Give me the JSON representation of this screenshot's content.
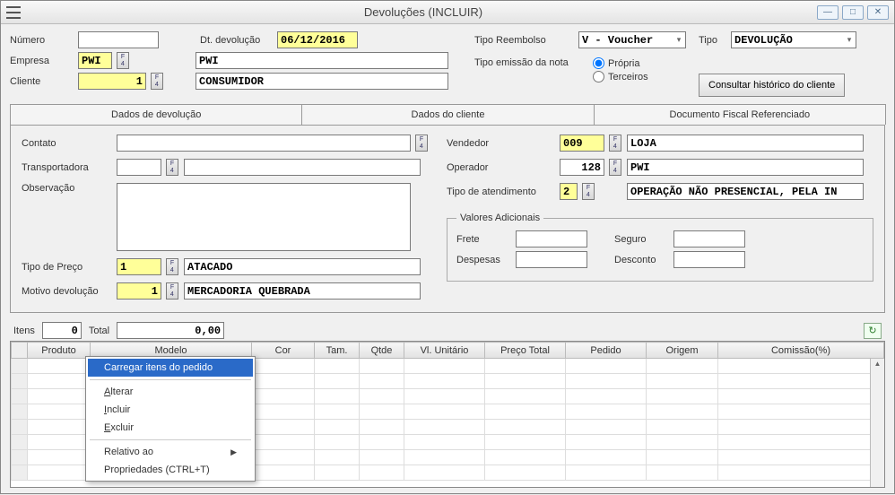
{
  "window": {
    "title": "Devoluções (INCLUIR)"
  },
  "header": {
    "numero_label": "Número",
    "numero_value": "",
    "dtdev_label": "Dt. devolução",
    "dtdev_value": "06/12/2016",
    "tiporeemb_label": "Tipo Reembolso",
    "tiporeemb_value": "V - Voucher",
    "tipo_label": "Tipo",
    "tipo_value": "DEVOLUÇÃO",
    "empresa_label": "Empresa",
    "empresa_code": "PWI",
    "empresa_name": "PWI",
    "tipoemissao_label": "Tipo emissão da nota",
    "radio_propria": "Própria",
    "radio_terceiros": "Terceiros",
    "cliente_label": "Cliente",
    "cliente_code": "1",
    "cliente_name": "CONSUMIDOR",
    "btn_historico": "Consultar histórico do cliente"
  },
  "tabs": {
    "t1": "Dados de devolução",
    "t2": "Dados do cliente",
    "t3": "Documento Fiscal Referenciado"
  },
  "devol": {
    "contato_label": "Contato",
    "contato_value": "",
    "transportadora_label": "Transportadora",
    "transportadora_code": "",
    "transportadora_name": "",
    "observacao_label": "Observação",
    "observacao_value": "",
    "tipopreco_label": "Tipo de Preço",
    "tipopreco_code": "1",
    "tipopreco_name": "ATACADO",
    "motivo_label": "Motivo devolução",
    "motivo_code": "1",
    "motivo_name": "MERCADORIA QUEBRADA",
    "vendedor_label": "Vendedor",
    "vendedor_code": "009",
    "vendedor_name": "LOJA",
    "operador_label": "Operador",
    "operador_code": "128",
    "operador_name": "PWI",
    "tipoat_label": "Tipo de atendimento",
    "tipoat_code": "2",
    "tipoat_name": "OPERAÇÃO NÃO PRESENCIAL, PELA IN",
    "valores_legend": "Valores Adicionais",
    "frete_label": "Frete",
    "frete_value": "",
    "seguro_label": "Seguro",
    "seguro_value": "",
    "despesas_label": "Despesas",
    "despesas_value": "",
    "desconto_label": "Desconto",
    "desconto_value": ""
  },
  "items": {
    "itens_label": "Itens",
    "itens_value": "0",
    "total_label": "Total",
    "total_value": "0,00",
    "cols": {
      "produto": "Produto",
      "modelo": "Modelo",
      "cor": "Cor",
      "tam": "Tam.",
      "qtde": "Qtde",
      "vlunit": "Vl. Unitário",
      "preco": "Preço Total",
      "pedido": "Pedido",
      "origem": "Origem",
      "comissao": "Comissão(%)"
    }
  },
  "context": {
    "carregar": "Carregar itens do pedido",
    "alterar": "Alterar",
    "incluir": "Incluir",
    "excluir": "Excluir",
    "relativo": "Relativo ao",
    "prop": "Propriedades (CTRL+T)"
  }
}
